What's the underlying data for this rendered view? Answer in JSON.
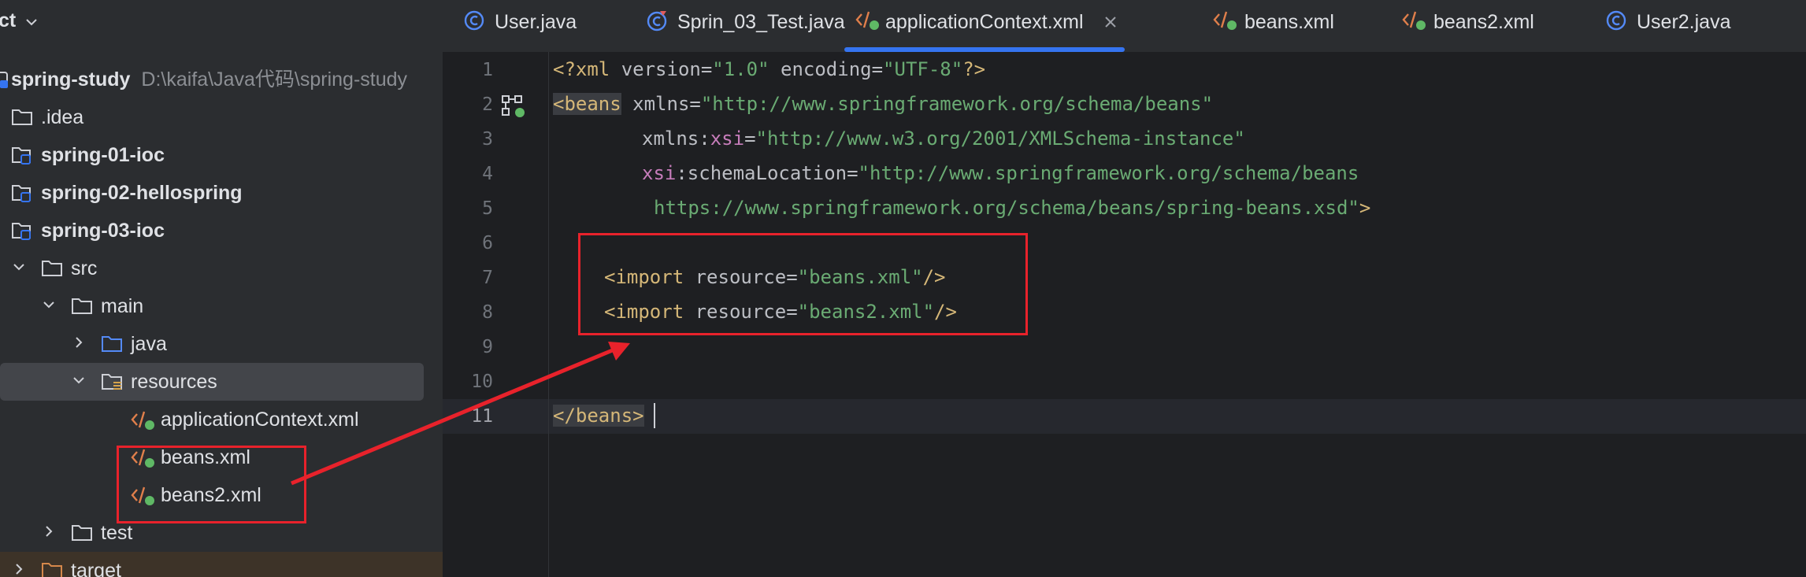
{
  "project": {
    "title": "ct",
    "root_name": "spring-study",
    "root_path": "D:\\kaifa\\Java代码\\spring-study",
    "items": [
      {
        "label": ".idea"
      },
      {
        "label": "spring-01-ioc"
      },
      {
        "label": "spring-02-hellospring"
      },
      {
        "label": "spring-03-ioc"
      },
      {
        "label": "src"
      },
      {
        "label": "main"
      },
      {
        "label": "java"
      },
      {
        "label": "resources"
      },
      {
        "label": "applicationContext.xml"
      },
      {
        "label": "beans.xml"
      },
      {
        "label": "beans2.xml"
      },
      {
        "label": "test"
      },
      {
        "label": "target"
      }
    ]
  },
  "tabs": [
    {
      "label": "User.java"
    },
    {
      "label": "Sprin_03_Test.java"
    },
    {
      "label": "applicationContext.xml"
    },
    {
      "label": "beans.xml"
    },
    {
      "label": "beans2.xml"
    },
    {
      "label": "User2.java"
    }
  ],
  "editor": {
    "line_numbers": [
      "1",
      "2",
      "3",
      "4",
      "5",
      "6",
      "7",
      "8",
      "9",
      "10",
      "11"
    ],
    "current_line": "11",
    "xml_decl": {
      "open": "<?xml ",
      "a1": "version=",
      "v1": "\"1.0\"",
      "a2": " encoding=",
      "v2": "\"UTF-8\"",
      "close": "?>"
    },
    "beans_open": "<beans",
    "xmlns_attr": " xmlns=",
    "xmlns_val": "\"http://www.springframework.org/schema/beans\"",
    "xmlns_xsi_prefix": "xmlns:",
    "xsi_ns": "xsi",
    "eq": "=",
    "xmlns_xsi_val": "\"http://www.w3.org/2001/XMLSchema-instance\"",
    "xsi_prefix": "xsi",
    "schema_attr": ":schemaLocation=",
    "schema_val_1": "\"http://www.springframework.org/schema/beans",
    "schema_val_2": "https://www.springframework.org/schema/beans/spring-beans.xsd\"",
    "tag_close": ">",
    "import_tag": "<import",
    "resource_attr": " resource=",
    "import1_val": "\"beans.xml\"",
    "import2_val": "\"beans2.xml\"",
    "self_close": "/>",
    "beans_close": "</beans>"
  },
  "colors": {
    "accent": "#3574f0",
    "annotation": "#e8222b",
    "tag": "#d5b778",
    "string": "#6aab73",
    "namespace": "#c77dbb"
  }
}
